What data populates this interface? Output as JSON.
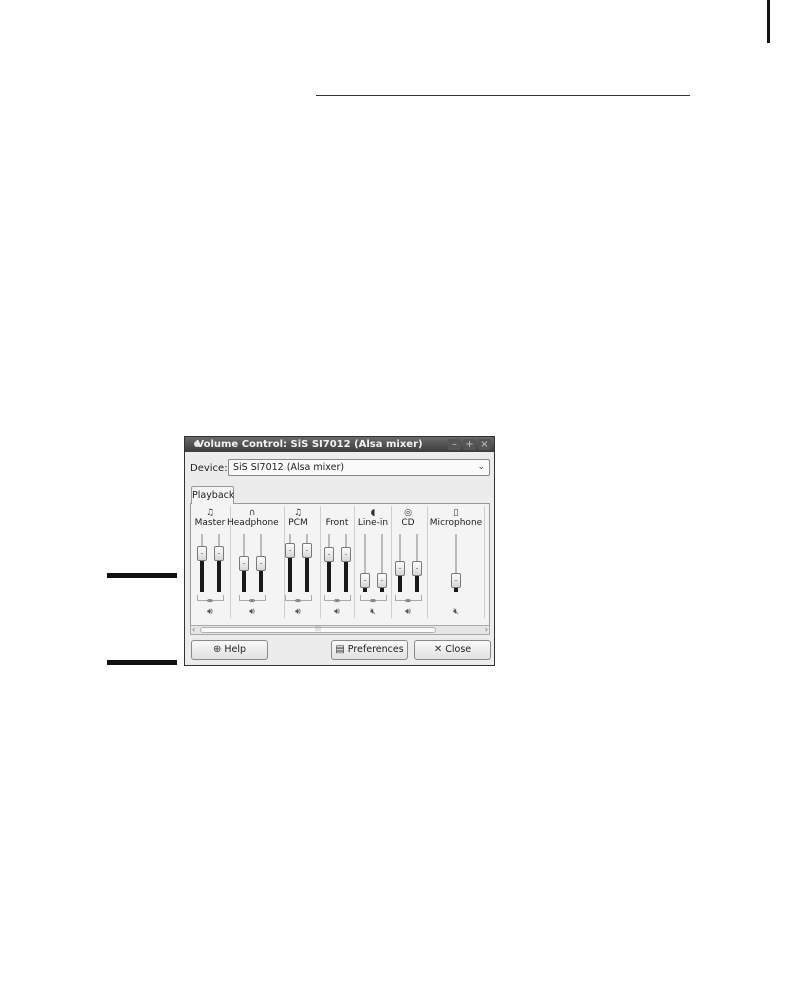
{
  "window": {
    "title": "Volume Control: SiS SI7012 (Alsa mixer)",
    "buttons": {
      "minimize_icon": "minimize-icon",
      "maximize_icon": "maximize-icon",
      "close_icon": "close-icon"
    }
  },
  "device": {
    "label": "Device:",
    "value": "SiS SI7012 (Alsa mixer)"
  },
  "tabs": [
    {
      "label": "Playback",
      "active": true
    }
  ],
  "channels": [
    {
      "label": "Master",
      "icon": "music-note-icon",
      "levels": [
        0.72,
        0.72
      ],
      "locked": true,
      "muted": false
    },
    {
      "label": "Headphone",
      "icon": "headphone-icon",
      "levels": [
        0.5,
        0.5
      ],
      "locked": true,
      "muted": false
    },
    {
      "label": "PCM",
      "icon": "music-note-icon",
      "levels": [
        0.8,
        0.8
      ],
      "locked": true,
      "muted": false
    },
    {
      "label": "Front",
      "icon": "none",
      "levels": [
        0.7,
        0.7
      ],
      "locked": true,
      "muted": false
    },
    {
      "label": "Line-in",
      "icon": "line-in-icon",
      "levels": [
        0.1,
        0.1
      ],
      "locked": true,
      "muted": true
    },
    {
      "label": "CD",
      "icon": "cd-icon",
      "levels": [
        0.38,
        0.38
      ],
      "locked": true,
      "muted": false
    },
    {
      "label": "Microphone",
      "icon": "microphone-icon",
      "levels": [
        0.1
      ],
      "locked": false,
      "muted": true
    }
  ],
  "buttons": {
    "help": "Help",
    "preferences": "Preferences",
    "close": "Close"
  },
  "scroll_grip": "|||"
}
